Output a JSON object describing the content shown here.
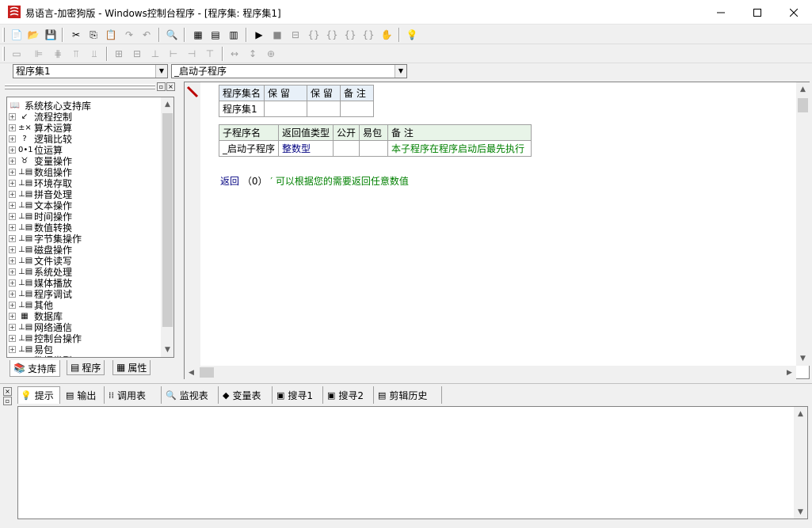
{
  "window": {
    "title": "易语言-加密狗版 - Windows控制台程序 - [程序集: 程序集1]",
    "minimize": "—",
    "maximize": "☐",
    "close": "✕"
  },
  "selectors": {
    "assembly_value": "程序集1",
    "subprogram_value": "_启动子程序"
  },
  "library_panel": {
    "root_label": "系统核心支持库",
    "items": [
      {
        "label": "流程控制",
        "icon": "↙"
      },
      {
        "label": "算术运算",
        "icon": "±×"
      },
      {
        "label": "逻辑比较",
        "icon": "?"
      },
      {
        "label": "位运算",
        "icon": "0•1"
      },
      {
        "label": "变量操作",
        "icon": "♉"
      },
      {
        "label": "数组操作",
        "icon": "⊥▤"
      },
      {
        "label": "环境存取",
        "icon": "⊥▤"
      },
      {
        "label": "拼音处理",
        "icon": "⊥▤"
      },
      {
        "label": "文本操作",
        "icon": "⊥▤"
      },
      {
        "label": "时间操作",
        "icon": "⊥▤"
      },
      {
        "label": "数值转换",
        "icon": "⊥▤"
      },
      {
        "label": "字节集操作",
        "icon": "⊥▤"
      },
      {
        "label": "磁盘操作",
        "icon": "⊥▤"
      },
      {
        "label": "文件读写",
        "icon": "⊥▤"
      },
      {
        "label": "系统处理",
        "icon": "⊥▤"
      },
      {
        "label": "媒体播放",
        "icon": "⊥▤"
      },
      {
        "label": "程序调试",
        "icon": "⊥▤"
      },
      {
        "label": "其他",
        "icon": "⊥▤"
      },
      {
        "label": "数据库",
        "icon": "▦"
      },
      {
        "label": "网络通信",
        "icon": "⊥▤"
      },
      {
        "label": "控制台操作",
        "icon": "⊥▤"
      },
      {
        "label": "易包",
        "icon": "⊥▤"
      },
      {
        "label": "数据类型",
        "icon": "◇◇"
      }
    ],
    "tabs": [
      "支持库",
      "程序",
      "属性"
    ]
  },
  "assembly_table": {
    "headers": [
      "程序集名",
      "保 留",
      "保 留",
      "备 注"
    ],
    "row": [
      "程序集1",
      "",
      "",
      ""
    ]
  },
  "subprogram_table": {
    "headers": [
      "子程序名",
      "返回值类型",
      "公开",
      "易包",
      "备 注"
    ],
    "row": [
      "_启动子程序",
      "整数型",
      "",
      "",
      "本子程序在程序启动后最先执行"
    ]
  },
  "code": {
    "keyword": "返回",
    "args": "（0）",
    "comment": "′ 可以根据您的需要返回任意数值"
  },
  "bottom_tabs": [
    {
      "label": "提示",
      "icon": "💡"
    },
    {
      "label": "输出",
      "icon": "▤"
    },
    {
      "label": "调用表",
      "icon": "⁞⁞"
    },
    {
      "label": "监视表",
      "icon": "🔍"
    },
    {
      "label": "变量表",
      "icon": "◆"
    },
    {
      "label": "搜寻1",
      "icon": "▣"
    },
    {
      "label": "搜寻2",
      "icon": "▣"
    },
    {
      "label": "剪辑历史",
      "icon": "▤"
    }
  ],
  "colors": {
    "comment_green": "#008000",
    "type_blue": "#000080",
    "header_green": "#e8f4e8"
  }
}
